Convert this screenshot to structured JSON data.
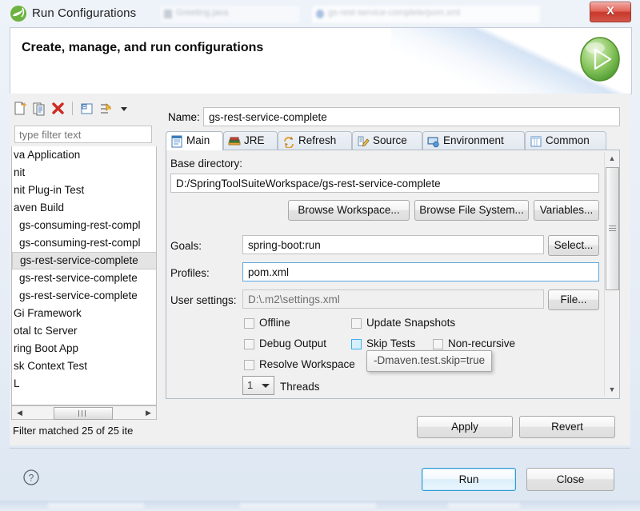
{
  "window": {
    "title": "Run Configurations",
    "logo_icon": "spring-leaf-icon",
    "close_label": "X",
    "background_tabs": [
      {
        "label": "Greeting.java"
      },
      {
        "label": "gs-rest-service-complete/pom.xml"
      }
    ]
  },
  "banner": {
    "title": "Create, manage, and run configurations",
    "icon": "run-green-play-icon"
  },
  "tree_toolbar": {
    "buttons": [
      {
        "name": "new-launch-configuration-icon",
        "tooltip": "New launch configuration"
      },
      {
        "name": "duplicate-icon",
        "tooltip": "Duplicate"
      },
      {
        "name": "delete-icon",
        "tooltip": "Delete"
      },
      {
        "name": "collapse-all-icon",
        "tooltip": "Collapse All"
      },
      {
        "name": "filter-launch-configurations-icon",
        "tooltip": "Filter launch configurations"
      },
      {
        "name": "view-menu-chevron-down-icon",
        "tooltip": "View Menu"
      }
    ]
  },
  "filter": {
    "placeholder": "type filter text",
    "value": "",
    "status": "Filter matched 25 of 25 ite"
  },
  "tree": {
    "items": [
      {
        "label": "va Application",
        "selected": false,
        "indent": false
      },
      {
        "label": "nit",
        "selected": false,
        "indent": false
      },
      {
        "label": "nit Plug-in Test",
        "selected": false,
        "indent": false
      },
      {
        "label": "aven Build",
        "selected": false,
        "indent": false
      },
      {
        "label": "gs-consuming-rest-compl",
        "selected": false,
        "indent": true
      },
      {
        "label": "gs-consuming-rest-compl",
        "selected": false,
        "indent": true
      },
      {
        "label": "gs-rest-service-complete",
        "selected": true,
        "indent": true
      },
      {
        "label": "gs-rest-service-complete",
        "selected": false,
        "indent": true
      },
      {
        "label": "gs-rest-service-complete",
        "selected": false,
        "indent": true
      },
      {
        "label": "Gi Framework",
        "selected": false,
        "indent": false
      },
      {
        "label": "otal tc Server",
        "selected": false,
        "indent": false
      },
      {
        "label": "ring Boot App",
        "selected": false,
        "indent": false
      },
      {
        "label": "sk Context Test",
        "selected": false,
        "indent": false
      },
      {
        "label": "L",
        "selected": false,
        "indent": false
      }
    ]
  },
  "config": {
    "name_label": "Name:",
    "name_value": "gs-rest-service-complete",
    "tabs": [
      {
        "label": "Main",
        "icon": "main-document-icon",
        "active": true
      },
      {
        "label": "JRE",
        "icon": "jre-books-icon",
        "active": false
      },
      {
        "label": "Refresh",
        "icon": "refresh-arrows-icon",
        "active": false
      },
      {
        "label": "Source",
        "icon": "source-pencil-icon",
        "active": false
      },
      {
        "label": "Environment",
        "icon": "environment-monitor-icon",
        "active": false
      },
      {
        "label": "Common",
        "icon": "common-window-icon",
        "active": false
      }
    ],
    "main": {
      "base_directory_label": "Base directory:",
      "base_directory_value": "D:/SpringToolSuiteWorkspace/gs-rest-service-complete",
      "browse_workspace_label": "Browse Workspace...",
      "browse_file_system_label": "Browse File System...",
      "variables_label": "Variables...",
      "goals_label": "Goals:",
      "goals_value": "spring-boot:run",
      "select_label": "Select...",
      "profiles_label": "Profiles:",
      "profiles_value": "pom.xml",
      "user_settings_label": "User settings:",
      "user_settings_value": "D:\\.m2\\settings.xml",
      "file_label": "File...",
      "checkboxes": [
        {
          "label": "Offline",
          "checked": false,
          "hover": false
        },
        {
          "label": "Update Snapshots",
          "checked": false,
          "hover": false
        },
        {
          "label": "Debug Output",
          "checked": false,
          "hover": false
        },
        {
          "label": "Skip Tests",
          "checked": false,
          "hover": true
        },
        {
          "label": "Non-recursive",
          "checked": false,
          "hover": false
        },
        {
          "label": "Resolve Workspace",
          "checked": false,
          "hover": false
        }
      ],
      "threads_value": "1",
      "threads_label": "Threads",
      "tooltip": "-Dmaven.test.skip=true"
    }
  },
  "actions": {
    "apply_label": "Apply",
    "revert_label": "Revert",
    "run_label": "Run",
    "close_label": "Close",
    "help_icon": "help-question-icon"
  },
  "colors": {
    "accent_blue": "#2d9bd6",
    "hover_cyan": "#d6f0fb",
    "spring_green": "#6db33f",
    "close_red": "#c8392c"
  }
}
